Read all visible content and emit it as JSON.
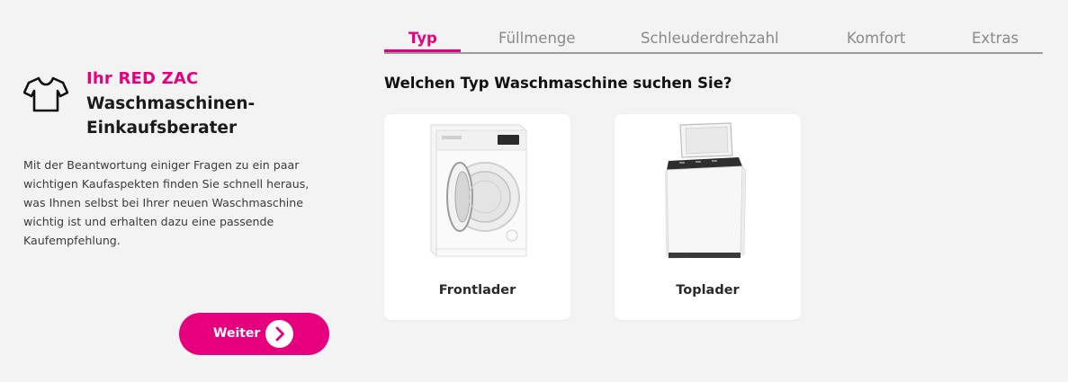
{
  "sidebar": {
    "icon": "tshirt-icon",
    "brand": "Ihr RED ZAC",
    "title_line1": "Waschmaschinen-",
    "title_line2": "Einkaufsberater",
    "description": "Mit der Beantwortung einiger Fragen zu ein paar wichtigen Kaufaspekten finden Sie schnell heraus, was Ihnen selbst bei Ihrer neuen Waschmaschine wichtig ist und erhalten dazu eine passende Kaufempfehlung.",
    "next_button": {
      "label": "Weiter",
      "icon": "chevron-right-icon"
    }
  },
  "tabs": [
    {
      "label": "Typ",
      "active": true
    },
    {
      "label": "Füllmenge",
      "active": false
    },
    {
      "label": "Schleuderdrehzahl",
      "active": false
    },
    {
      "label": "Komfort",
      "active": false
    },
    {
      "label": "Extras",
      "active": false
    }
  ],
  "question": "Welchen Typ Waschmaschine suchen Sie?",
  "options": [
    {
      "label": "Frontlader",
      "image": "front-loader-washing-machine"
    },
    {
      "label": "Toplader",
      "image": "top-loader-washing-machine"
    }
  ],
  "colors": {
    "accent": "#e6007e",
    "background": "#f3f3f3",
    "card": "#ffffff",
    "inactive_tab": "#8a8a8a"
  }
}
